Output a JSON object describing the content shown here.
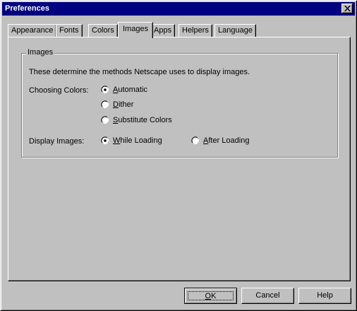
{
  "window": {
    "title": "Preferences"
  },
  "tabs": [
    {
      "label": "Appearance"
    },
    {
      "label": "Fonts"
    },
    {
      "label": "Colors"
    },
    {
      "label": "Images"
    },
    {
      "label": "Apps"
    },
    {
      "label": "Helpers"
    },
    {
      "label": "Language"
    }
  ],
  "active_tab": "Images",
  "images_group": {
    "title": "Images",
    "description": "These determine the methods Netscape uses to display images.",
    "choosing_colors": {
      "label": "Choosing Colors:",
      "selected": "Automatic",
      "options": [
        {
          "label": "Automatic",
          "mnemonic": "A",
          "rest": "utomatic"
        },
        {
          "label": "Dither",
          "mnemonic": "D",
          "rest": "ither"
        },
        {
          "label": "Substitute Colors",
          "mnemonic": "S",
          "rest": "ubstitute Colors"
        }
      ]
    },
    "display_images": {
      "label": "Display Images:",
      "selected": "While Loading",
      "options": [
        {
          "label": "While Loading",
          "mnemonic": "W",
          "rest": "hile Loading"
        },
        {
          "label": "After Loading",
          "mnemonic": "A",
          "rest": "fter Loading"
        }
      ]
    }
  },
  "buttons": {
    "ok": {
      "label": "OK",
      "mnemonic": "O",
      "rest": "K"
    },
    "cancel": "Cancel",
    "help": "Help"
  }
}
